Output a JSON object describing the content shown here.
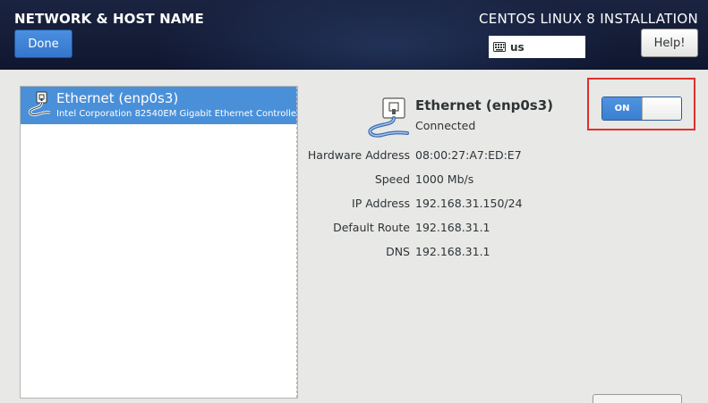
{
  "header": {
    "spoke_title": "NETWORK & HOST NAME",
    "done_label": "Done",
    "product_title": "CENTOS LINUX 8 INSTALLATION",
    "keyboard_layout": "us",
    "help_label": "Help!"
  },
  "device_list": {
    "items": [
      {
        "name": "Ethernet (enp0s3)",
        "description": "Intel Corporation 82540EM Gigabit Ethernet Controller (",
        "selected": true,
        "icon": "ethernet-cable-icon"
      }
    ]
  },
  "device_detail": {
    "icon": "ethernet-cable-icon",
    "name": "Ethernet (enp0s3)",
    "status": "Connected",
    "switch_label": "ON",
    "switch_on": true,
    "properties": [
      {
        "label": "Hardware Address",
        "value": "08:00:27:A7:ED:E7"
      },
      {
        "label": "Speed",
        "value": "1000 Mb/s"
      },
      {
        "label": "IP Address",
        "value": "192.168.31.150/24"
      },
      {
        "label": "Default Route",
        "value": "192.168.31.1"
      },
      {
        "label": "DNS",
        "value": "192.168.31.1"
      }
    ]
  },
  "colors": {
    "header_bg": "#141c36",
    "accent_blue": "#4a90d9",
    "highlight_red": "#e0302a",
    "panel_bg": "#e8e8e7"
  }
}
